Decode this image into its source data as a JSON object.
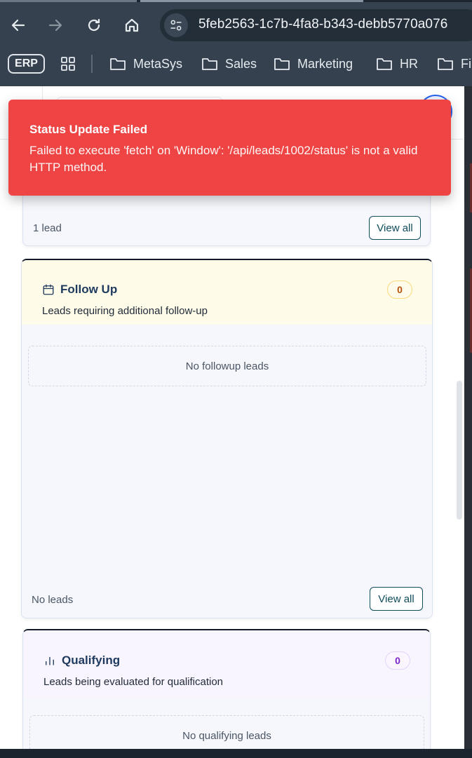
{
  "browser": {
    "url": "5feb2563-1c7b-4fa8-b343-debb5770a076",
    "bookmarks": [
      {
        "label": "ERP"
      },
      {
        "label": "MetaSys"
      },
      {
        "label": "Sales"
      },
      {
        "label": "Marketing"
      },
      {
        "label": "HR"
      },
      {
        "label": "Fi"
      }
    ]
  },
  "toast": {
    "title": "Status Update Failed",
    "message": "Failed to execute 'fetch' on 'Window': '/api/leads/1002/status' is not a valid HTTP method."
  },
  "cards": [
    {
      "footer_text": "1 lead",
      "view_all_label": "View all"
    },
    {
      "title": "Follow Up",
      "description": "Leads requiring additional follow-up",
      "count": "0",
      "empty_text": "No followup leads",
      "footer_text": "No leads",
      "view_all_label": "View all",
      "icon": "calendar-icon",
      "header_color": "#fefbe8",
      "badge_color": "#b45309"
    },
    {
      "title": "Qualifying",
      "description": "Leads being evaluated for qualification",
      "count": "0",
      "empty_text": "No qualifying leads",
      "icon": "bar-chart-icon",
      "header_color": "#f9f5fe",
      "badge_color": "#7e22ce"
    }
  ]
}
